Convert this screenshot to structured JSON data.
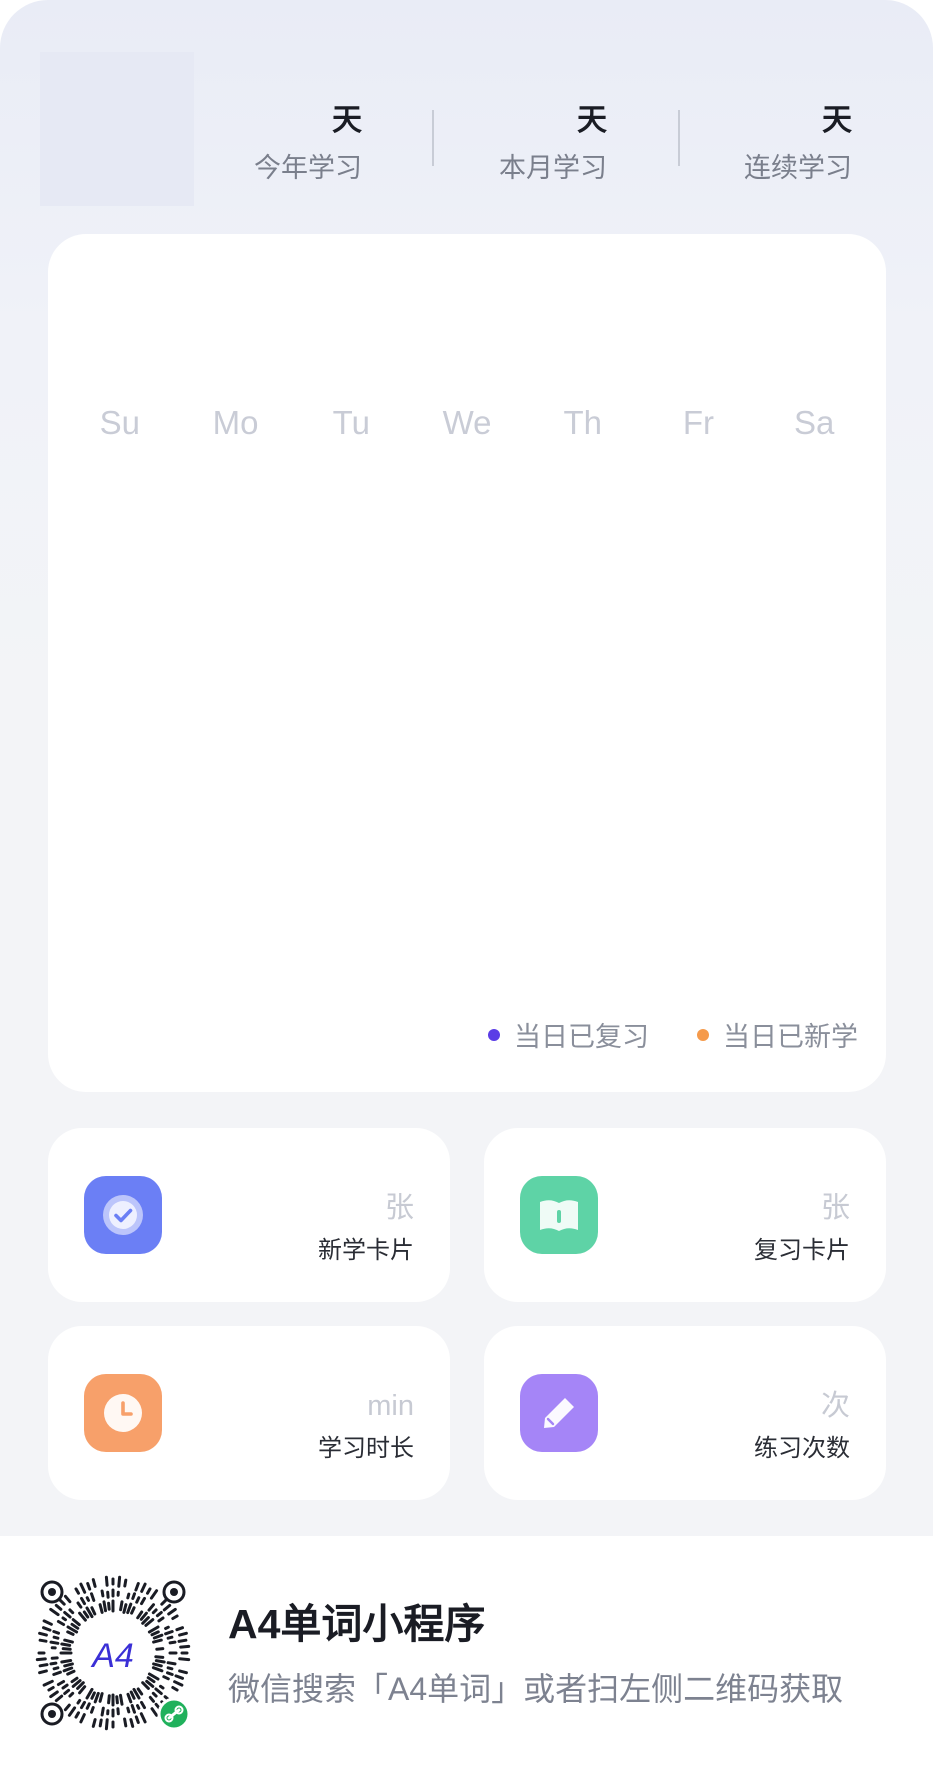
{
  "stats": [
    {
      "unit": "天",
      "label": "今年学习"
    },
    {
      "unit": "天",
      "label": "本月学习"
    },
    {
      "unit": "天",
      "label": "连续学习"
    }
  ],
  "calendar": {
    "weekdays": [
      "Su",
      "Mo",
      "Tu",
      "We",
      "Th",
      "Fr",
      "Sa"
    ],
    "legend": [
      {
        "label": "当日已复习",
        "color": "#5b3de6"
      },
      {
        "label": "当日已新学",
        "color": "#f59a4b"
      }
    ]
  },
  "cards": [
    {
      "unit": "张",
      "label": "新学卡片",
      "icon": "check-circle-icon",
      "color": "#6b7ff5"
    },
    {
      "unit": "张",
      "label": "复习卡片",
      "icon": "book-icon",
      "color": "#5ed3a6"
    },
    {
      "unit": "min",
      "label": "学习时长",
      "icon": "clock-icon",
      "color": "#f7a06a"
    },
    {
      "unit": "次",
      "label": "练习次数",
      "icon": "pencil-icon",
      "color": "#a585f7"
    }
  ],
  "footer": {
    "qr_text": "A4",
    "title": "A4单词小程序",
    "subtitle": "微信搜索「A4单词」或者扫左侧二维码获取"
  }
}
